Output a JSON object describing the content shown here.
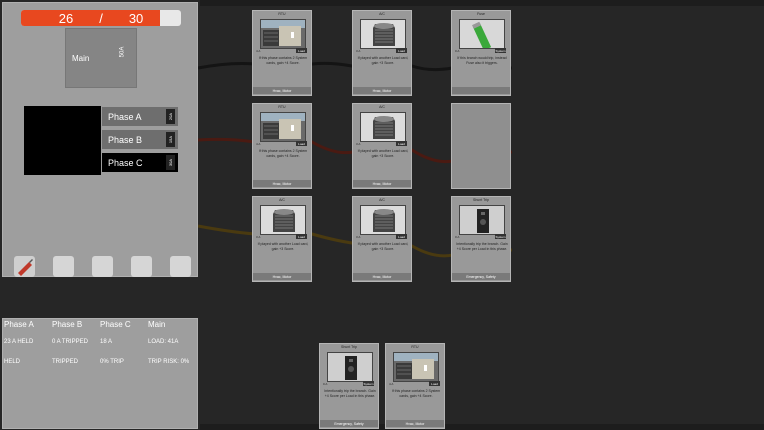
{
  "counter": {
    "current": "26",
    "separator": "/",
    "max": "30",
    "fill_fraction": 0.867
  },
  "main_breaker": {
    "label": "Main",
    "amp": "50A"
  },
  "phases": [
    {
      "label": "Phase A",
      "amp": "20A",
      "active": false
    },
    {
      "label": "Phase B",
      "amp": "15A",
      "active": false
    },
    {
      "label": "Phase C",
      "amp": "30A",
      "active": true
    }
  ],
  "toolbar": {
    "slots": [
      "tool-slot",
      "empty-slot",
      "empty-slot",
      "empty-slot",
      "empty-slot"
    ]
  },
  "stats": {
    "headers": [
      "Phase A",
      "Phase B",
      "Phase C",
      "Main"
    ],
    "row1": [
      "23 A HELD",
      "0 A TRIPPED",
      "18 A",
      "LOAD: 41A"
    ],
    "row2": [
      "HELD",
      "TRIPPED",
      "0% TRIP",
      "TRIP RISK: 0%"
    ]
  },
  "board_cards": [
    {
      "title": "RTU",
      "cost": "4 A",
      "badge": "Load",
      "desc": "If this phase contains 2 System cards, gain +4 Score.",
      "tags": "Hvac, Motor",
      "art": "rtu"
    },
    {
      "title": "A/C",
      "cost": "3 A",
      "badge": "Load",
      "desc": "If played with another Load card, gain +3 Score.",
      "tags": "Hvac, Motor",
      "art": "ac"
    },
    {
      "title": "Fuse",
      "cost": "0 A",
      "badge": "System",
      "desc": "If this branch would trip, instead Fuse also it triggers.",
      "tags": "",
      "art": "fuse"
    },
    {
      "title": "RTU",
      "cost": "4 A",
      "badge": "Load",
      "desc": "If this phase contains 2 System cards, gain +4 Score.",
      "tags": "Hvac, Motor",
      "art": "rtu"
    },
    {
      "title": "A/C",
      "cost": "3 A",
      "badge": "Load",
      "desc": "If played with another Load card, gain +3 Score.",
      "tags": "Hvac, Motor",
      "art": "ac"
    },
    {
      "title": "",
      "cost": "",
      "badge": "",
      "desc": "",
      "tags": "",
      "art": "empty"
    },
    {
      "title": "A/C",
      "cost": "3 A",
      "badge": "Load",
      "desc": "If played with another Load card, gain +3 Score.",
      "tags": "Hvac, Motor",
      "art": "ac"
    },
    {
      "title": "A/C",
      "cost": "3 A",
      "badge": "Load",
      "desc": "If played with another Load card, gain +3 Score.",
      "tags": "Hvac, Motor",
      "art": "ac"
    },
    {
      "title": "Shunt Trip",
      "cost": "0 A",
      "badge": "System",
      "desc": "Intentionally trip the branch. Gain +4 Score per Load in this phase.",
      "tags": "Emergency, Safety",
      "art": "shunt"
    }
  ],
  "hand_cards": [
    {
      "title": "Shunt Trip",
      "cost": "0 A",
      "badge": "System",
      "desc": "Intentionally trip the branch. Gain +4 Score per Load in this phase.",
      "tags": "Emergency, Safety",
      "art": "shunt"
    },
    {
      "title": "RTU",
      "cost": "4 A",
      "badge": "Load",
      "desc": "If this phase contains 2 System cards, gain +4 Score.",
      "tags": "Hvac, Motor",
      "art": "rtu"
    }
  ],
  "colors": {
    "counter_fill": "#e8481f",
    "wire_a": "#1a1a1a",
    "wire_b": "#4a1a12",
    "wire_c": "#4a3a10"
  }
}
